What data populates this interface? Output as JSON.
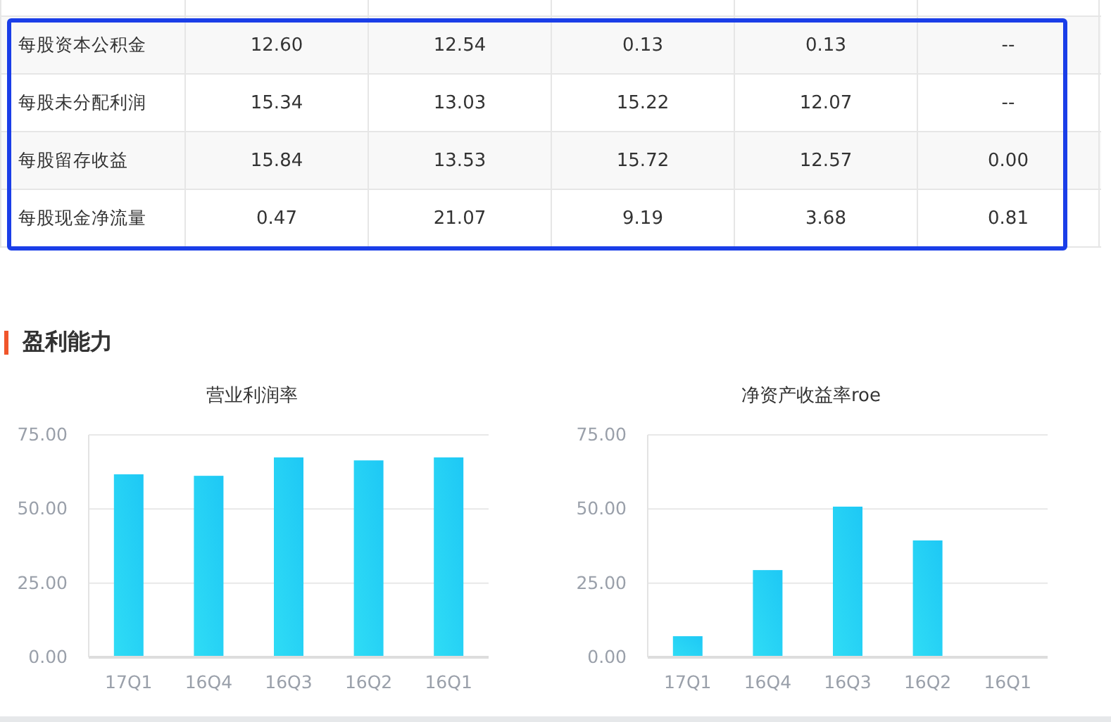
{
  "table": {
    "rows": [
      {
        "label": "每股资本公积金",
        "cells": [
          "12.60",
          "12.54",
          "0.13",
          "0.13",
          "--"
        ]
      },
      {
        "label": "每股未分配利润",
        "cells": [
          "15.34",
          "13.03",
          "15.22",
          "12.07",
          "--"
        ]
      },
      {
        "label": "每股留存收益",
        "cells": [
          "15.84",
          "13.53",
          "15.72",
          "12.57",
          "0.00"
        ]
      },
      {
        "label": "每股现金净流量",
        "cells": [
          "0.47",
          "21.07",
          "9.19",
          "3.68",
          "0.81"
        ]
      }
    ]
  },
  "section": {
    "title": "盈利能力"
  },
  "charts": [
    {
      "chart_data": {
        "type": "bar",
        "title": "营业利润率",
        "categories": [
          "17Q1",
          "16Q4",
          "16Q3",
          "16Q2",
          "16Q1"
        ],
        "series": [
          {
            "color": "#1ec8f5",
            "values": [
              61.7,
              61.2,
              67.4,
              66.4,
              67.4
            ]
          }
        ],
        "ylim": [
          0,
          75
        ],
        "yticks": [
          {
            "value": 0,
            "label": "0.00"
          },
          {
            "value": 25,
            "label": "25.00"
          },
          {
            "value": 50,
            "label": "50.00"
          },
          {
            "value": 75,
            "label": "75.00"
          }
        ]
      }
    },
    {
      "chart_data": {
        "type": "bar",
        "title": "净资产收益率roe",
        "categories": [
          "17Q1",
          "16Q4",
          "16Q3",
          "16Q2",
          "16Q1"
        ],
        "series": [
          {
            "color": "#1ec8f5",
            "values": [
              7.1,
              29.4,
              50.8,
              39.4,
              null
            ]
          }
        ],
        "ylim": [
          0,
          75
        ],
        "yticks": [
          {
            "value": 0,
            "label": "0.00"
          },
          {
            "value": 25,
            "label": "25.00"
          },
          {
            "value": 50,
            "label": "50.00"
          },
          {
            "value": 75,
            "label": "75.00"
          }
        ]
      }
    }
  ]
}
